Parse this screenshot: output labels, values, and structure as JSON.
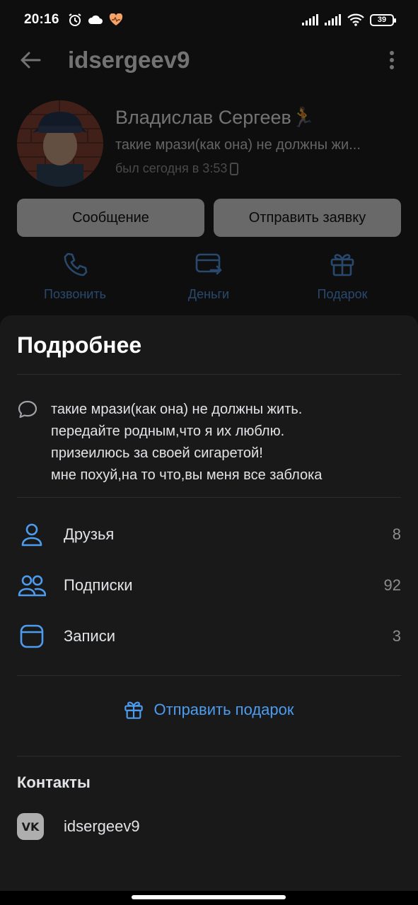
{
  "status_bar": {
    "time": "20:16",
    "battery": "39",
    "icons": [
      "alarm-icon",
      "cloud-icon",
      "heart-icon",
      "signal-icon",
      "signal-icon",
      "wifi-icon",
      "battery-icon"
    ]
  },
  "header": {
    "title": "idsergeev9"
  },
  "profile": {
    "name": "Владислав Сергеев🏃",
    "status": "такие мрази(как она) не должны жи...",
    "last_seen": "был сегодня в 3:53"
  },
  "actions": {
    "message_label": "Сообщение",
    "request_label": "Отправить заявку"
  },
  "quick_actions": {
    "call": "Позвонить",
    "money": "Деньги",
    "gift": "Подарок"
  },
  "details": {
    "title": "Подробнее",
    "about_lines": [
      "такие мрази(как она) не должны жить.",
      "передайте родным,что я их люблю.",
      "призеилюсь за своей сигаретой!",
      "мне похуй,на то что,вы меня все заблока"
    ],
    "friends": {
      "label": "Друзья",
      "count": "8"
    },
    "subscriptions": {
      "label": "Подписки",
      "count": "92"
    },
    "posts": {
      "label": "Записи",
      "count": "3"
    },
    "gift_link": "Отправить подарок"
  },
  "contacts": {
    "title": "Контакты",
    "vk_badge": "VK",
    "vk_id": "idsergeev9"
  },
  "colors": {
    "accent": "#4d9cf0",
    "sheet_bg": "#191919",
    "button_bg": "#e8e8e8"
  }
}
